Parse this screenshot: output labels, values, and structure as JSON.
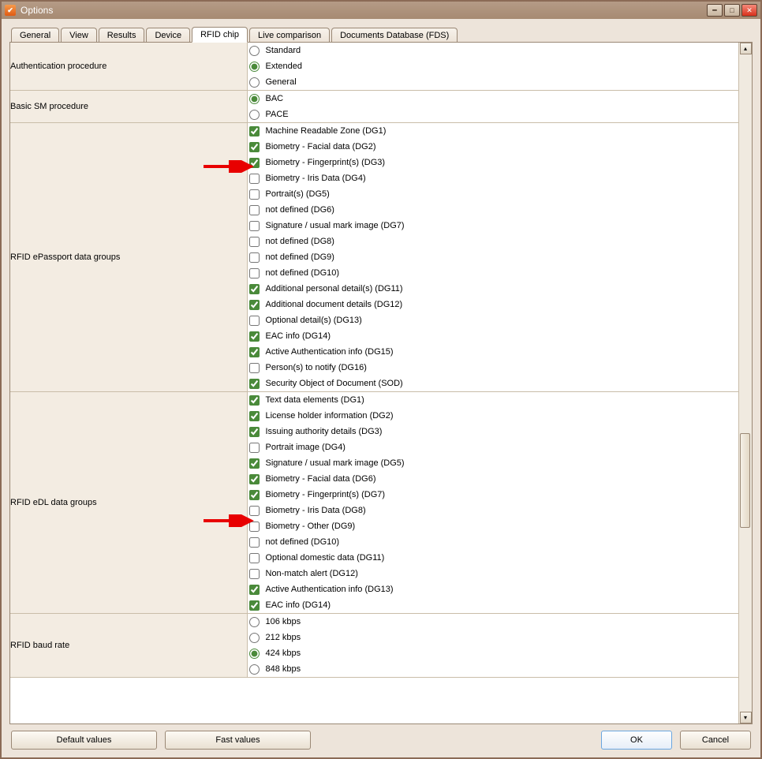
{
  "window": {
    "title": "Options"
  },
  "tabs": {
    "items": [
      {
        "label": "General",
        "active": false
      },
      {
        "label": "View",
        "active": false
      },
      {
        "label": "Results",
        "active": false
      },
      {
        "label": "Device",
        "active": false
      },
      {
        "label": "RFID chip",
        "active": true
      },
      {
        "label": "Live comparison",
        "active": false
      },
      {
        "label": "Documents Database (FDS)",
        "active": false
      }
    ]
  },
  "sections": {
    "auth_proc": {
      "label": "Authentication procedure",
      "options": [
        {
          "label": "Standard",
          "selected": false
        },
        {
          "label": "Extended",
          "selected": true
        },
        {
          "label": "General",
          "selected": false
        }
      ]
    },
    "basic_sm": {
      "label": "Basic SM procedure",
      "options": [
        {
          "label": "BAC",
          "selected": true
        },
        {
          "label": "PACE",
          "selected": false
        }
      ]
    },
    "epassport": {
      "label": "RFID ePassport data groups",
      "items": [
        {
          "label": "Machine Readable Zone (DG1)",
          "checked": true
        },
        {
          "label": "Biometry - Facial data (DG2)",
          "checked": true
        },
        {
          "label": "Biometry - Fingerprint(s) (DG3)",
          "checked": true
        },
        {
          "label": "Biometry - Iris Data (DG4)",
          "checked": false
        },
        {
          "label": "Portrait(s) (DG5)",
          "checked": false
        },
        {
          "label": "not defined (DG6)",
          "checked": false
        },
        {
          "label": "Signature / usual mark image (DG7)",
          "checked": false
        },
        {
          "label": "not defined (DG8)",
          "checked": false
        },
        {
          "label": "not defined (DG9)",
          "checked": false
        },
        {
          "label": "not defined (DG10)",
          "checked": false
        },
        {
          "label": "Additional personal detail(s) (DG11)",
          "checked": true
        },
        {
          "label": "Additional document details (DG12)",
          "checked": true
        },
        {
          "label": "Optional detail(s) (DG13)",
          "checked": false
        },
        {
          "label": "EAC info (DG14)",
          "checked": true
        },
        {
          "label": "Active Authentication info (DG15)",
          "checked": true
        },
        {
          "label": "Person(s) to notify (DG16)",
          "checked": false
        },
        {
          "label": "Security Object of Document (SOD)",
          "checked": true
        }
      ]
    },
    "edl": {
      "label": "RFID eDL data groups",
      "items": [
        {
          "label": "Text data elements (DG1)",
          "checked": true
        },
        {
          "label": "License holder information (DG2)",
          "checked": true
        },
        {
          "label": "Issuing authority details (DG3)",
          "checked": true
        },
        {
          "label": "Portrait image (DG4)",
          "checked": false
        },
        {
          "label": "Signature / usual mark image (DG5)",
          "checked": true
        },
        {
          "label": "Biometry - Facial data (DG6)",
          "checked": true
        },
        {
          "label": "Biometry - Fingerprint(s) (DG7)",
          "checked": true
        },
        {
          "label": "Biometry - Iris Data (DG8)",
          "checked": false
        },
        {
          "label": "Biometry - Other (DG9)",
          "checked": false
        },
        {
          "label": "not defined (DG10)",
          "checked": false
        },
        {
          "label": "Optional domestic data (DG11)",
          "checked": false
        },
        {
          "label": "Non-match alert (DG12)",
          "checked": false
        },
        {
          "label": "Active Authentication info (DG13)",
          "checked": true
        },
        {
          "label": "EAC info (DG14)",
          "checked": true
        }
      ]
    },
    "baud": {
      "label": "RFID baud rate",
      "options": [
        {
          "label": "106 kbps",
          "selected": false
        },
        {
          "label": "212 kbps",
          "selected": false
        },
        {
          "label": "424 kbps",
          "selected": true
        },
        {
          "label": "848 kbps",
          "selected": false
        }
      ]
    }
  },
  "footer": {
    "default_values": "Default values",
    "fast_values": "Fast values",
    "ok": "OK",
    "cancel": "Cancel"
  },
  "annotations": {
    "arrow1_target": "epassport-dg3",
    "arrow2_target": "edl-dg7"
  }
}
